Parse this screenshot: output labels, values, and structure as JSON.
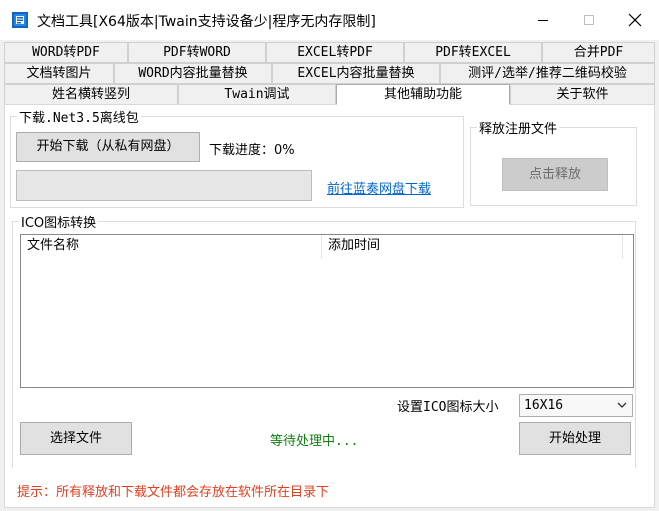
{
  "window": {
    "title": "文档工具[X64版本|Twain支持设备少|程序无内存限制]",
    "controls": {
      "minimize": "minimize-icon",
      "maximize": "maximize-icon",
      "close": "close-icon"
    }
  },
  "tabs": {
    "row1": [
      "WORD转PDF",
      "PDF转WORD",
      "EXCEL转PDF",
      "PDF转EXCEL",
      "合并PDF"
    ],
    "row2": [
      "文档转图片",
      "WORD内容批量替换",
      "EXCEL内容批量替换",
      "测评/选举/推荐二维码校验"
    ],
    "row3": [
      "姓名横转竖列",
      "Twain调试",
      "其他辅助功能",
      "关于软件"
    ],
    "active": "其他辅助功能"
  },
  "download_group": {
    "title": "下载.Net3.5离线包",
    "start_button": "开始下载（从私有网盘）",
    "progress_label": "下载进度：0%",
    "progress_value": 0,
    "link": "前往蓝奏网盘下载"
  },
  "register_group": {
    "title": "释放注册文件",
    "release_button": "点击释放"
  },
  "ico_group": {
    "title": "ICO图标转换",
    "columns": [
      "文件名称",
      "添加时间",
      ""
    ],
    "rows": [],
    "size_label": "设置ICO图标大小",
    "size_value": "16X16",
    "select_button": "选择文件",
    "status": "等待处理中...",
    "process_button": "开始处理"
  },
  "hint": "提示：所有释放和下载文件都会存放在软件所在目录下",
  "colors": {
    "status": "#108010",
    "hint": "#e04020",
    "link": "#0066cc"
  }
}
